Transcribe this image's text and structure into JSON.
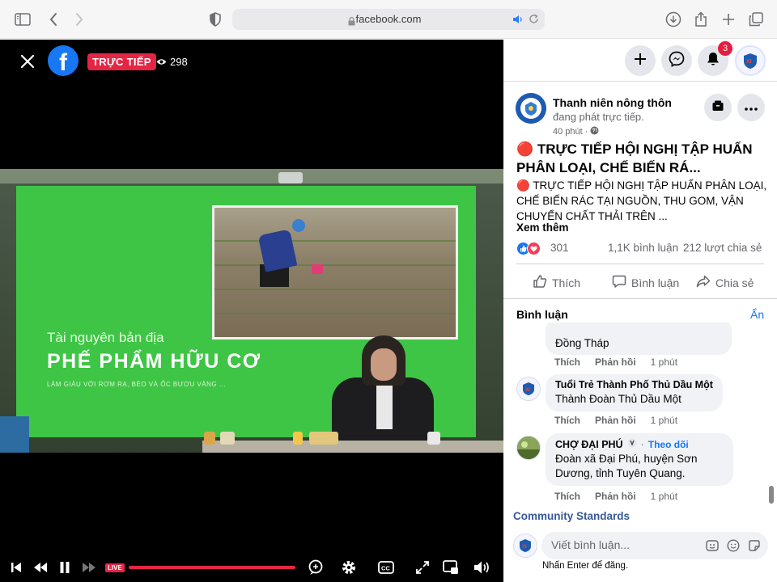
{
  "browser": {
    "url": "facebook.com"
  },
  "video": {
    "live_label": "TRỰC TIẾP",
    "viewer_count": "298",
    "live_chip": "LIVE",
    "slide": {
      "subtitle": "Tài nguyên bản địa",
      "title": "PHẾ PHẨM HỮU CƠ",
      "small_text": "LÀM GIÀU VỚI RƠM RẠ, BÈO VÀ ỐC BƯƠU VÀNG ..."
    }
  },
  "panel": {
    "notification_count": "3",
    "page_name": "Thanh niên nông thôn",
    "page_status": "đang phát trực tiếp.",
    "post_time": "40 phút ·",
    "post_title": "🔴 TRỰC TIẾP HỘI NGHỊ TẬP HUẤN PHÂN LOẠI, CHẾ BIẾN RÁ...",
    "post_body": "🔴 TRỰC TIẾP HỘI NGHỊ TẬP HUẤN PHÂN LOẠI, CHẾ BIẾN RÁC TẠI NGUỒN, THU GOM, VẬN CHUYỂN CHẤT THẢI TRÊN ...",
    "see_more": "Xem thêm",
    "reaction_count": "301",
    "comment_count": "1,1K bình luận",
    "share_count": "212 lượt chia sẻ",
    "actions": {
      "like": "Thích",
      "comment": "Bình luận",
      "share": "Chia sẻ"
    },
    "comments_heading": "Bình luận",
    "hide_label": "Ẩn",
    "comments": [
      {
        "text": "Đồng Tháp",
        "like": "Thích",
        "reply": "Phản hồi",
        "time": "1 phút"
      },
      {
        "author": "Tuổi Trẻ Thành Phố Thủ Dầu Một",
        "text": "Thành Đoàn Thủ Dầu Một",
        "like": "Thích",
        "reply": "Phản hồi",
        "time": "1 phút"
      },
      {
        "author": "CHỢ ĐẠI PHÚ",
        "follow": "Theo dõi",
        "text": "Đoàn xã Đại Phú, huyện Sơn Dương, tỉnh Tuyên Quang.",
        "like": "Thích",
        "reply": "Phản hồi",
        "time": "1 phút"
      }
    ],
    "community_standards": "Community Standards",
    "compose_placeholder": "Viết bình luận...",
    "enter_hint": "Nhấn Enter để đăng."
  },
  "colors": {
    "facebook_blue": "#1877f2",
    "live_red": "#e42645",
    "slide_green": "#3ec545"
  }
}
